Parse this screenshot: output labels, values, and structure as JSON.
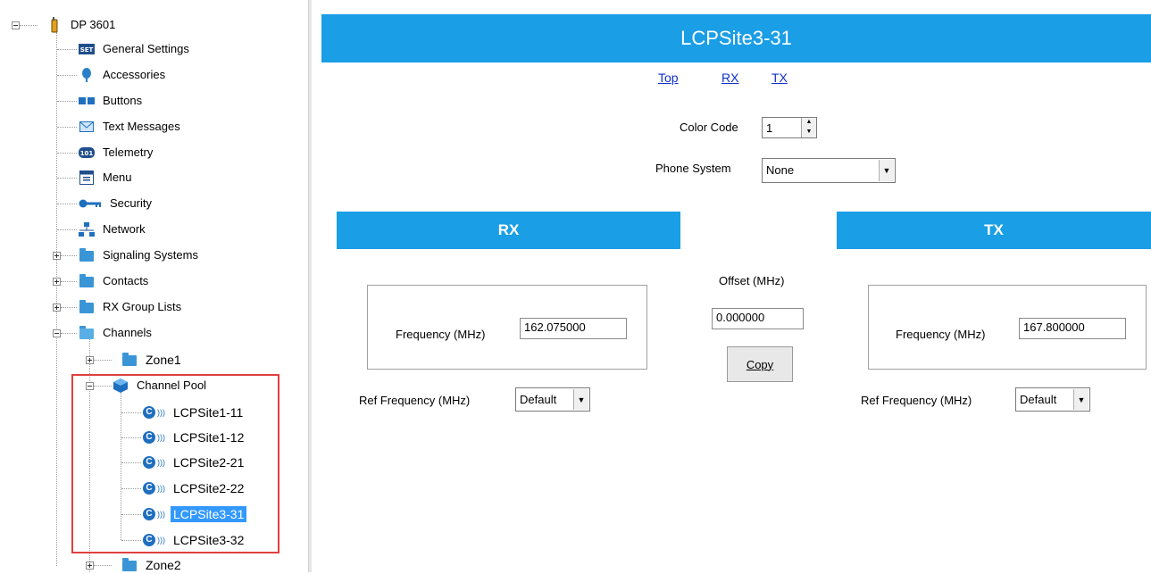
{
  "tree": {
    "root": "DP 3601",
    "items": [
      {
        "label": "General Settings",
        "icon": "settings-icon"
      },
      {
        "label": "Accessories",
        "icon": "accessories-icon"
      },
      {
        "label": "Buttons",
        "icon": "buttons-icon"
      },
      {
        "label": "Text Messages",
        "icon": "envelope-icon"
      },
      {
        "label": "Telemetry",
        "icon": "telemetry-icon"
      },
      {
        "label": "Menu",
        "icon": "menu-icon"
      },
      {
        "label": "Security",
        "icon": "key-icon"
      },
      {
        "label": "Network",
        "icon": "network-icon"
      },
      {
        "label": "Signaling Systems",
        "icon": "folder-icon"
      },
      {
        "label": "Contacts",
        "icon": "folder-icon"
      },
      {
        "label": "RX Group Lists",
        "icon": "folder-icon"
      },
      {
        "label": "Channels",
        "icon": "folder-open-icon"
      }
    ],
    "zone1": "Zone1",
    "channel_pool": "Channel Pool",
    "channels": [
      "LCPSite1-11",
      "LCPSite1-12",
      "LCPSite2-21",
      "LCPSite2-22",
      "LCPSite3-31",
      "LCPSite3-32"
    ],
    "selected": "LCPSite3-31",
    "zone2": "Zone2",
    "settings_icon_text": "SET",
    "telemetry_icon_text": "101"
  },
  "panel": {
    "title": "LCPSite3-31",
    "links": {
      "top": "Top",
      "rx": "RX",
      "tx": "TX"
    },
    "color_code_label": "Color Code",
    "color_code_value": "1",
    "phone_system_label": "Phone System",
    "phone_system_value": "None",
    "rx": {
      "header": "RX",
      "frequency_label": "Frequency (MHz)",
      "frequency_value": "162.075000",
      "ref_frequency_label": "Ref Frequency (MHz)",
      "ref_frequency_value": "Default"
    },
    "offset_label": "Offset (MHz)",
    "offset_value": "0.000000",
    "copy_label": "Copy",
    "tx": {
      "header": "TX",
      "frequency_label": "Frequency (MHz)",
      "frequency_value": "167.800000",
      "ref_frequency_label": "Ref Frequency (MHz)",
      "ref_frequency_value": "Default"
    }
  },
  "colors": {
    "accent": "#1a9ee6",
    "selection": "#3399ff",
    "link": "#1030c8",
    "highlight_box": "#e04040"
  }
}
